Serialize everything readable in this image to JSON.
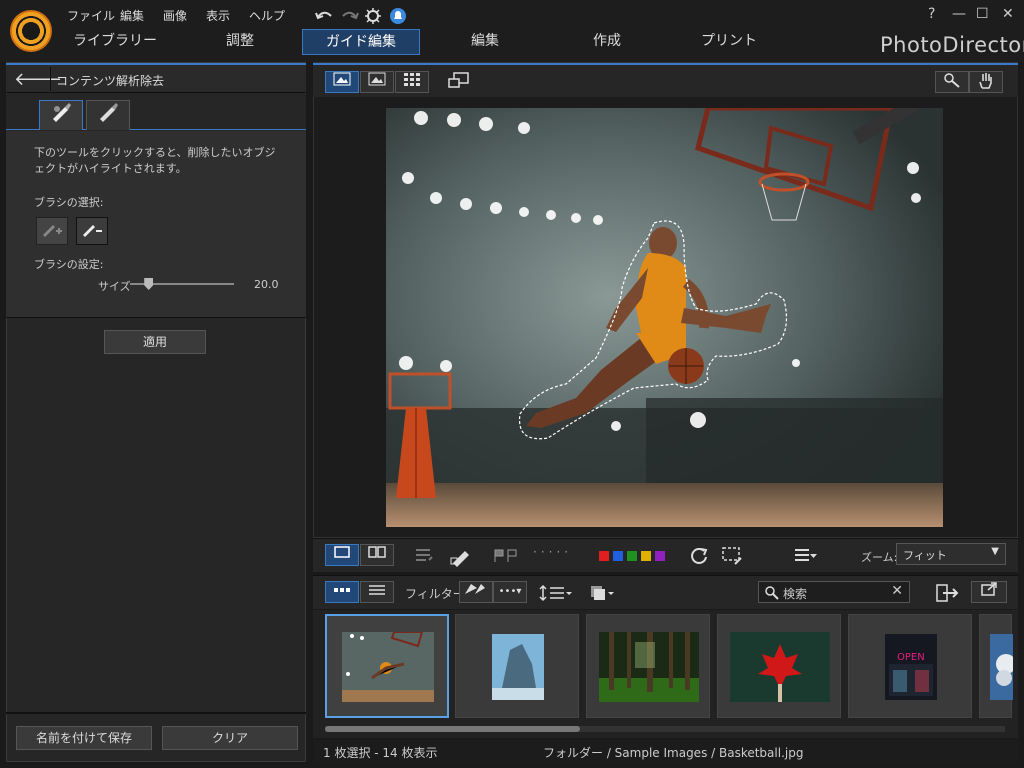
{
  "menu": [
    "ファイル",
    "編集",
    "画像",
    "表示",
    "ヘルプ"
  ],
  "tabs": [
    "ライブラリー",
    "調整",
    "ガイド編集",
    "編集",
    "作成",
    "プリント"
  ],
  "active_tab": "ガイド編集",
  "brand": "PhotoDirector",
  "window_buttons": {
    "help": "?",
    "minimize": "—",
    "maximize": "☐",
    "close": "✕"
  },
  "left_panel": {
    "title": "コンテンツ解析除去",
    "instruction": "下のツールをクリックすると、削除したいオブジェクトがハイライトされます。",
    "brush_select_label": "ブラシの選択:",
    "brush_settings_label": "ブラシの設定:",
    "size_label": "サイズ",
    "size_value": "20.0",
    "size_level": 0.18,
    "apply_label": "適用",
    "save_as_label": "名前を付けて保存",
    "clear_label": "クリア"
  },
  "toolbar_bottom": {
    "zoom_label": "ズーム:",
    "zoom_value": "フィット",
    "color_labels": [
      "#e02020",
      "#2060e0",
      "#209020",
      "#e0b000",
      "#9020c0"
    ]
  },
  "library_bar": {
    "filter_label": "フィルター:",
    "search_placeholder": "検索"
  },
  "status": {
    "selection": "1 枚選択 - 14 枚表示",
    "path": "フォルダー / Sample Images / Basketball.jpg"
  },
  "colors": {
    "accent": "#3a7ac8",
    "background": "#1a1a1a"
  }
}
